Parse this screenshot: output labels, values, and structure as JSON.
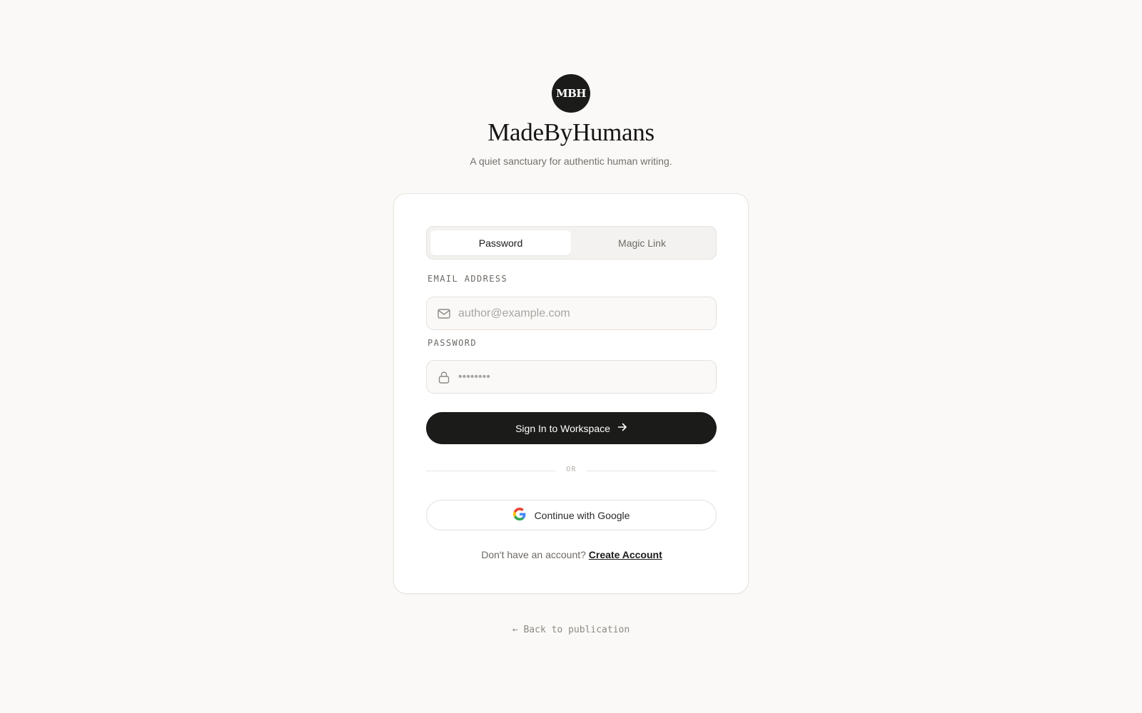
{
  "brand": {
    "badge": "MBH",
    "title": "MadeByHumans",
    "tagline": "A quiet sanctuary for authentic human writing."
  },
  "auth_tabs": [
    {
      "label": "Password",
      "active": true
    },
    {
      "label": "Magic Link",
      "active": false
    }
  ],
  "email": {
    "label": "EMAIL ADDRESS",
    "placeholder": "author@example.com",
    "icon": "mail-icon"
  },
  "password": {
    "label": "PASSWORD",
    "placeholder": "••••••••",
    "icon": "lock-icon"
  },
  "sign_in_button": {
    "label": "Sign In to Workspace",
    "icon": "arrow-right-icon"
  },
  "divider_text": "OR",
  "google_button": {
    "label": "Continue with Google",
    "icon": "google-icon"
  },
  "signup": {
    "prompt": "Don't have an account?",
    "link": "Create Account"
  },
  "back_link": "← Back to publication",
  "colors": {
    "background": "#faf9f7",
    "primary": "#1b1b1a",
    "card": "#ffffff",
    "muted_text": "#75716c"
  }
}
